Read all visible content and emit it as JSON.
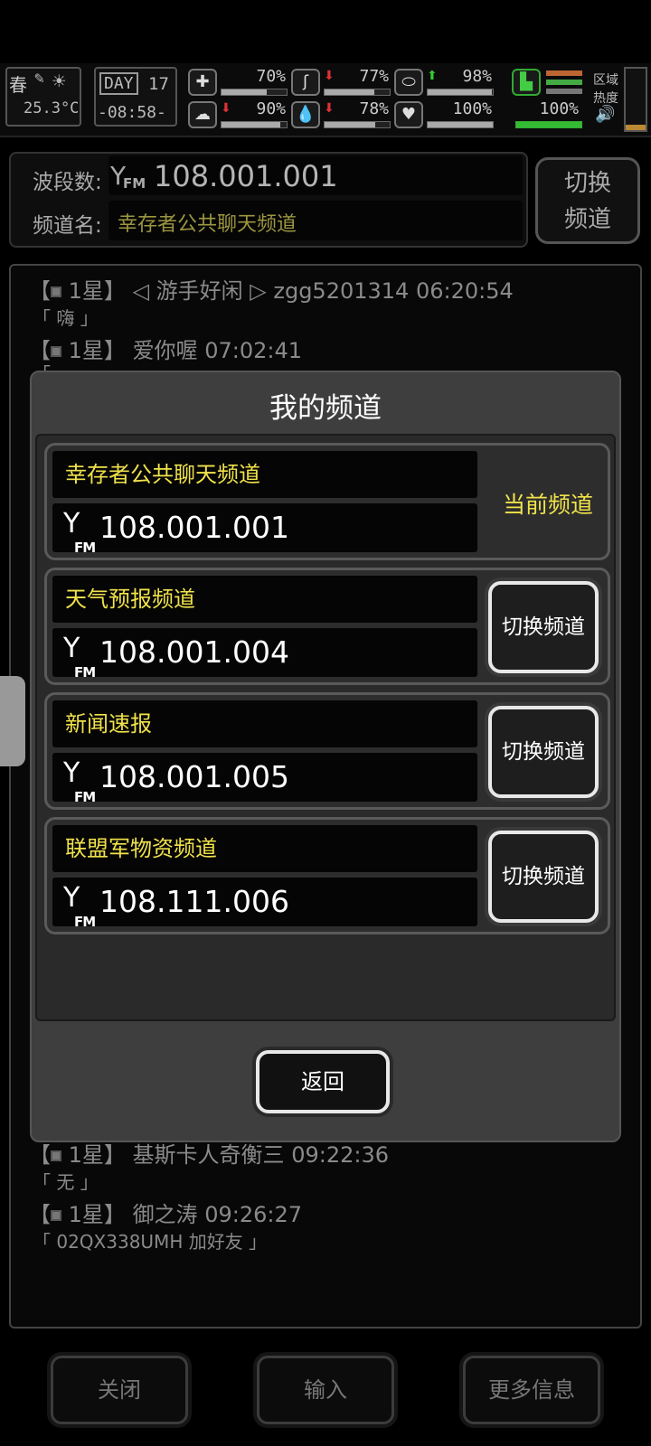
{
  "status": {
    "season": "春",
    "temperature": "25.3°C",
    "day_label": "DAY",
    "day_number": "17",
    "clock": "-08:58-",
    "stats": [
      {
        "icon": "medkit-icon",
        "value": "70%",
        "fill": 0.7
      },
      {
        "icon": "stomach-icon",
        "value": "77%",
        "fill": 0.77
      },
      {
        "icon": "capsule-icon",
        "value": "98%",
        "fill": 0.98
      },
      {
        "icon": "brain-icon",
        "value": "90%",
        "fill": 0.9
      },
      {
        "icon": "water-drop-icon",
        "value": "78%",
        "fill": 0.78
      },
      {
        "icon": "heart-icon",
        "value": "100%",
        "fill": 1.0
      },
      {
        "icon": "boot-icon",
        "value": "100%",
        "fill": 1.0
      }
    ],
    "region_label_1": "区域",
    "region_label_2": "热度",
    "volume_icon": "speaker-icon"
  },
  "channel_info": {
    "band_label": "波段数:",
    "band_value": "108.001.001",
    "name_label": "频道名:",
    "name_value": "幸存者公共聊天频道",
    "switch_line1": "切换",
    "switch_line2": "频道"
  },
  "chat": {
    "messages": [
      {
        "star": "【",
        "level": "1星】",
        "header": "◁ 游手好闲 ▷ zgg5201314 06:20:54",
        "body": "「 嗨 」"
      },
      {
        "star": "【",
        "level": "1星】",
        "header": "爱你喔 07:02:41",
        "body": "「 ..."
      },
      {
        "star": "【",
        "level": "1星】",
        "header": "基斯卡人奇衡三 09:22:36",
        "body": "「 无 」"
      },
      {
        "star": "【",
        "level": "1星】",
        "header": "御之涛 09:26:27",
        "body": "「 02QX338UMH  加好友 」"
      }
    ]
  },
  "modal": {
    "title": "我的频道",
    "fm_text": "FM",
    "current_label": "当前频道",
    "switch_label": "切换频道",
    "channels": [
      {
        "name": "幸存者公共聊天频道",
        "freq": "108.001.001"
      },
      {
        "name": "天气预报频道",
        "freq": "108.001.004"
      },
      {
        "name": "新闻速报",
        "freq": "108.001.005"
      },
      {
        "name": "联盟军物资频道",
        "freq": "108.111.006"
      }
    ],
    "back_label": "返回"
  },
  "bottom": {
    "close_label": "关闭",
    "input_label": "输入",
    "more_label": "更多信息"
  }
}
